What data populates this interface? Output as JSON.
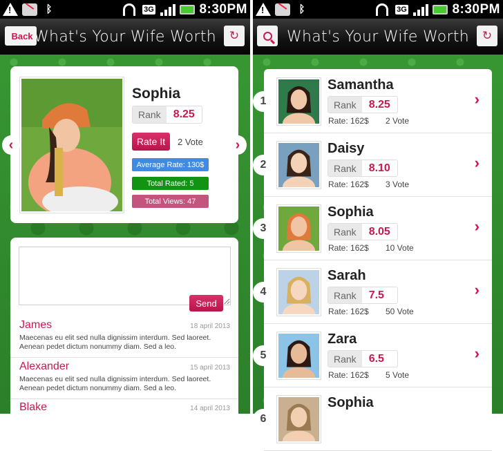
{
  "status": {
    "time": "8:30PM",
    "network": "3G"
  },
  "app": {
    "title": "What's Your Wife Worth",
    "back_label": "Back"
  },
  "profile": {
    "name": "Sophia",
    "rank_label": "Rank",
    "rank_value": "8.25",
    "rate_button": "Rate It",
    "votes": "2 Vote",
    "average_rate": "Average Rate: 130$",
    "total_rated": "Total Rated: 5",
    "total_views": "Total Views: 47"
  },
  "comments": {
    "send_label": "Send",
    "items": [
      {
        "name": "James",
        "date": "18 april 2013",
        "text": "Maecenas eu elit sed nulla dignissim interdum. Sed laoreet. Aenean pedet dictum nonummy diam. Sed a leo."
      },
      {
        "name": "Alexander",
        "date": "15 april 2013",
        "text": "Maecenas eu elit sed nulla dignissim interdum. Sed laoreet. Aenean pedet dictum nonummy diam. Sed a leo."
      },
      {
        "name": "Blake",
        "date": "14 april 2013",
        "text": ""
      }
    ]
  },
  "ranking": {
    "rank_label": "Rank",
    "rows": [
      {
        "pos": "1",
        "name": "Samantha",
        "rank": "8.25",
        "rate": "Rate: 162$",
        "votes": "2 Vote"
      },
      {
        "pos": "2",
        "name": "Daisy",
        "rank": "8.10",
        "rate": "Rate: 162$",
        "votes": "3 Vote"
      },
      {
        "pos": "3",
        "name": "Sophia",
        "rank": "8.05",
        "rate": "Rate: 162$",
        "votes": "10 Vote"
      },
      {
        "pos": "4",
        "name": "Sarah",
        "rank": "7.5",
        "rate": "Rate: 162$",
        "votes": "50 Vote"
      },
      {
        "pos": "5",
        "name": "Zara",
        "rank": "6.5",
        "rate": "Rate: 162$",
        "votes": "5 Vote"
      },
      {
        "pos": "6",
        "name": "Sophia",
        "rank": "",
        "rate": "",
        "votes": ""
      }
    ]
  },
  "colors": {
    "accent": "#c8194f",
    "average": "#3d8be6",
    "total_rated": "#139313",
    "total_views": "#c3547e",
    "background_green": "#2e8a2e"
  },
  "icons": [
    "alert-icon",
    "missed-call-icon",
    "bluetooth-icon",
    "wifi-icon",
    "3g-icon",
    "signal-icon",
    "battery-icon",
    "search-icon",
    "refresh-icon",
    "chevron-right-icon",
    "chevron-left-icon"
  ]
}
